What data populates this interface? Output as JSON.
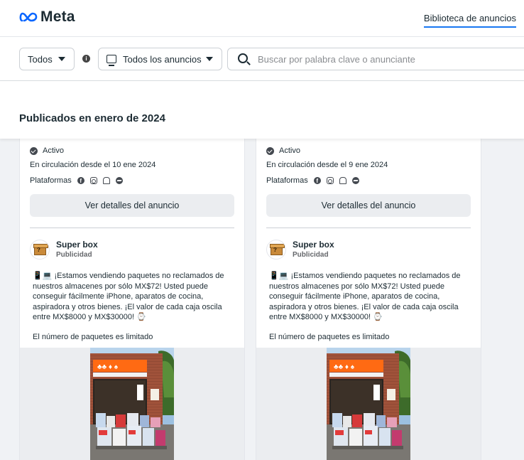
{
  "header": {
    "brand": "Meta",
    "nav_link": "Biblioteca de anuncios"
  },
  "filters": {
    "category": "Todos",
    "ad_type": "Todos los anuncios",
    "search_placeholder": "Buscar por palabra clave o anunciante"
  },
  "section_title": "Publicados en enero de 2024",
  "cards": [
    {
      "status": "Activo",
      "since": "En circulación desde el 10 ene 2024",
      "platforms_label": "Plataformas",
      "details_button": "Ver detalles del anuncio",
      "advertiser": "Super box",
      "advertiser_sub": "Publicidad",
      "body": "📱💻 ¡Estamos vendiendo paquetes no reclamados de nuestros almacenes por sólo MX$72! Usted puede conseguir fácilmente iPhone, aparatos de cocina, aspiradora y otros bienes. ¡El valor de cada caja oscila entre MX$8000 y MX$30000! ⌚",
      "body2": "El número de paquetes es limitado"
    },
    {
      "status": "Activo",
      "since": "En circulación desde el 9 ene 2024",
      "platforms_label": "Plataformas",
      "details_button": "Ver detalles del anuncio",
      "advertiser": "Super box",
      "advertiser_sub": "Publicidad",
      "body": "📱💻 ¡Estamos vendiendo paquetes no reclamados de nuestros almacenes por sólo MX$72! Usted puede conseguir fácilmente iPhone, aparatos de cocina, aspiradora y otros bienes. ¡El valor de cada caja oscila entre MX$8000 y MX$30000! ⌚",
      "body2": "El número de paquetes es limitado"
    }
  ],
  "platform_icons": [
    "facebook-icon",
    "instagram-icon",
    "audience-network-icon",
    "messenger-icon"
  ],
  "colors": {
    "accent": "#1877f2",
    "background": "#f0f2f5",
    "text": "#1c2b33"
  }
}
